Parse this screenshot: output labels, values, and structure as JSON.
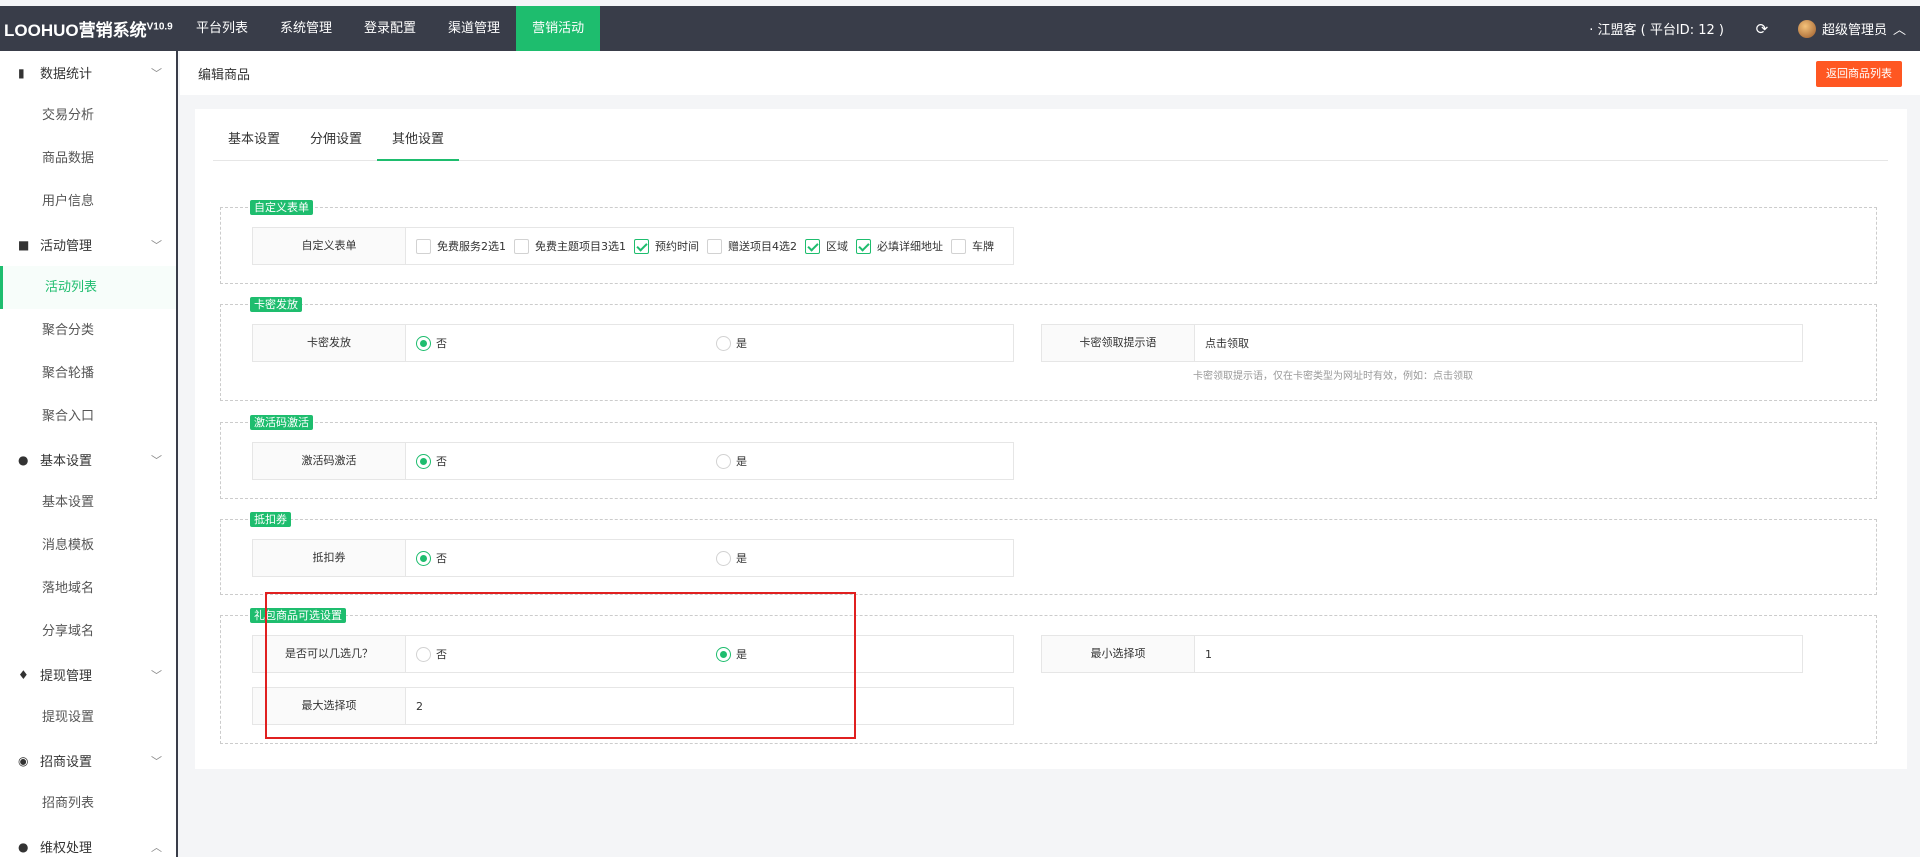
{
  "app": {
    "title": "LOOHUO营销系统",
    "version": "V10.9"
  },
  "nav": {
    "items": [
      "平台列表",
      "系统管理",
      "登录配置",
      "渠道管理",
      "营销活动"
    ]
  },
  "header": {
    "tenant": "· 江盟客 ( 平台ID: 12 )",
    "user": "超级管理员",
    "refresh_icon": "refresh-icon"
  },
  "sidebar": {
    "groups": [
      {
        "label": "数据统计",
        "icon": "bar-chart-icon",
        "items": [
          "交易分析",
          "商品数据",
          "用户信息"
        ]
      },
      {
        "label": "活动管理",
        "icon": "lock-icon",
        "items": [
          "活动列表",
          "聚合分类",
          "聚合轮播",
          "聚合入口"
        ]
      },
      {
        "label": "基本设置",
        "icon": "gear-icon",
        "items": [
          "基本设置",
          "消息模板",
          "落地域名",
          "分享域名"
        ]
      },
      {
        "label": "提现管理",
        "icon": "money-bag-icon",
        "items": [
          "提现设置"
        ]
      },
      {
        "label": "招商设置",
        "icon": "compass-icon",
        "items": [
          "招商列表"
        ]
      },
      {
        "label": "维权处理",
        "icon": "user-icon",
        "items": []
      }
    ],
    "active_item": "活动列表"
  },
  "page": {
    "breadcrumb": "编辑商品",
    "back_button": "返回商品列表"
  },
  "tabs": [
    "基本设置",
    "分佣设置",
    "其他设置"
  ],
  "sections": {
    "custom_form": {
      "legend": "自定义表单",
      "label": "自定义表单",
      "options": [
        {
          "label": "免费服务2选1",
          "checked": false
        },
        {
          "label": "免费主题项目3选1",
          "checked": false
        },
        {
          "label": "预约时间",
          "checked": true
        },
        {
          "label": "赠送项目4选2",
          "checked": false
        },
        {
          "label": "区域",
          "checked": true
        },
        {
          "label": "必填详细地址",
          "checked": true
        },
        {
          "label": "车牌",
          "checked": false
        }
      ]
    },
    "card_issue": {
      "legend": "卡密发放",
      "label": "卡密发放",
      "no": "否",
      "yes": "是",
      "prompt_label": "卡密领取提示语",
      "prompt_value": "点击领取",
      "prompt_hint": "卡密领取提示语，仅在卡密类型为网址时有效，例如：点击领取"
    },
    "activation": {
      "legend": "激活码激活",
      "label": "激活码激活",
      "no": "否",
      "yes": "是"
    },
    "coupon": {
      "legend": "抵扣券",
      "label": "抵扣券",
      "no": "否",
      "yes": "是"
    },
    "package": {
      "legend": "礼包商品可选设置",
      "label": "是否可以几选几？",
      "no": "否",
      "yes": "是",
      "min_label": "最小选择项",
      "min_value": "1",
      "max_label": "最大选择项",
      "max_value": "2"
    }
  },
  "colors": {
    "accent": "#1ebd6e",
    "topbar": "#393d49",
    "danger": "#ff5722",
    "highlight": "#e02020"
  }
}
